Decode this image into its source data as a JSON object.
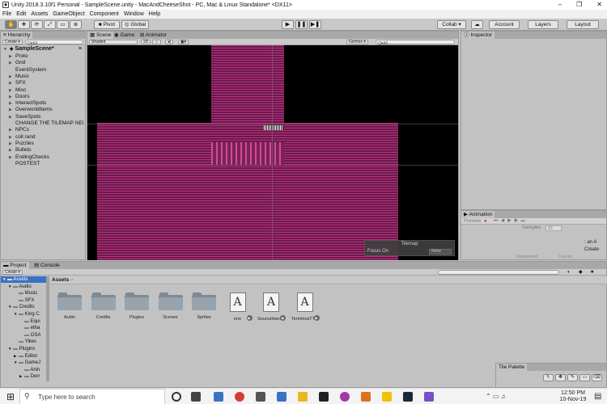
{
  "window": {
    "title": "Unity 2018.3.10f1 Personal - SampleScene.unity - MacAndCheeseShot - PC, Mac & Linux Standalone* <DX11>",
    "controls": [
      "–",
      "❐",
      "✕"
    ]
  },
  "menu": [
    "File",
    "Edit",
    "Assets",
    "GameObject",
    "Component",
    "Window",
    "Help"
  ],
  "toolbar": {
    "tools": [
      "✋",
      "✥",
      "⟳",
      "⤢",
      "▭",
      "⊕"
    ],
    "pivot_label": "Pivot",
    "global_label": "Global",
    "play": "▶",
    "pause": "❚❚",
    "step": "▶❚",
    "collab_label": "Collab ▾",
    "cloud_icon": "☁",
    "account_label": "Account",
    "layers_label": "Layers",
    "layout_label": "Layout"
  },
  "hierarchy": {
    "tab": "Hierarchy",
    "create_label": "Create ▾",
    "search_prefix": "Q▾All",
    "scene_name": "SampleScene*",
    "items": [
      {
        "label": "Proto",
        "arrow": "▶"
      },
      {
        "label": "Grid",
        "arrow": "▶"
      },
      {
        "label": "EventSystem",
        "arrow": ""
      },
      {
        "label": "Music",
        "arrow": "▶"
      },
      {
        "label": "SFX",
        "arrow": "▶"
      },
      {
        "label": "Misc",
        "arrow": "▶"
      },
      {
        "label": "Doors",
        "arrow": "▶"
      },
      {
        "label": "InteractSpots",
        "arrow": "▶"
      },
      {
        "label": "OverworldItems",
        "arrow": "▶"
      },
      {
        "label": "SaveSpots",
        "arrow": "▶"
      },
      {
        "label": "CHANGE THE TILEMAP NEI",
        "arrow": ""
      },
      {
        "label": "NPCs",
        "arrow": "▶"
      },
      {
        "label": "coll rand",
        "arrow": "▶"
      },
      {
        "label": "Puzzles",
        "arrow": "▶"
      },
      {
        "label": "Bullets",
        "arrow": "▶"
      },
      {
        "label": "EndingChecks",
        "arrow": "▶"
      },
      {
        "label": "POSTEST",
        "arrow": ""
      }
    ]
  },
  "scene": {
    "tabs": [
      "Scene",
      "Game",
      "Animator"
    ],
    "shading": "Shaded",
    "mode_2d": "2D",
    "gizmos": "Gizmos ▾",
    "search_prefix": "Q▾All",
    "tilemap_overlay": {
      "title": "Tilemap",
      "focus_label": "Focus On",
      "focus_value": "None"
    }
  },
  "inspector": {
    "tab": "Inspector"
  },
  "animation": {
    "tab": "Animation",
    "preview_label": "Preview",
    "samples_label": "Samples",
    "samples_value": "60",
    "dopesheet_label": "Dopesheet",
    "curves_label": "Curves",
    "side_text_1": ": an A",
    "side_text_2": "Create"
  },
  "project": {
    "tabs": [
      "Project",
      "Console"
    ],
    "create_label": "Create ▾",
    "breadcrumb": "Assets",
    "tree": [
      {
        "label": "Assets",
        "indent": 0,
        "arrow": "▼",
        "selected": true
      },
      {
        "label": "Audio",
        "indent": 1,
        "arrow": "▼"
      },
      {
        "label": "Music",
        "indent": 2,
        "arrow": ""
      },
      {
        "label": "SFX",
        "indent": 2,
        "arrow": ""
      },
      {
        "label": "Credits",
        "indent": 1,
        "arrow": "▼"
      },
      {
        "label": "King C",
        "indent": 2,
        "arrow": "▼"
      },
      {
        "label": "Equi",
        "indent": 3,
        "arrow": ""
      },
      {
        "label": "etha",
        "indent": 3,
        "arrow": ""
      },
      {
        "label": "OSA",
        "indent": 3,
        "arrow": ""
      },
      {
        "label": "Yikes",
        "indent": 2,
        "arrow": ""
      },
      {
        "label": "Plugins",
        "indent": 1,
        "arrow": "▼"
      },
      {
        "label": "Editor",
        "indent": 2,
        "arrow": "▶"
      },
      {
        "label": "GameJ",
        "indent": 2,
        "arrow": "▼"
      },
      {
        "label": "Anin",
        "indent": 3,
        "arrow": ""
      },
      {
        "label": "Derr",
        "indent": 3,
        "arrow": "▶"
      }
    ],
    "assets": [
      {
        "label": "Audio",
        "type": "folder"
      },
      {
        "label": "Credits",
        "type": "folder"
      },
      {
        "label": "Plugins",
        "type": "folder"
      },
      {
        "label": "Scenes",
        "type": "folder"
      },
      {
        "label": "Sprites",
        "type": "folder"
      },
      {
        "label": "enn",
        "type": "font"
      },
      {
        "label": "SourceHanSi...",
        "type": "font"
      },
      {
        "label": "TerminusTT...",
        "type": "font"
      }
    ],
    "font_glyph": "A",
    "expand_glyph": "▶"
  },
  "tile_palette": {
    "tab": "Tile Palette"
  },
  "taskbar": {
    "search_placeholder": "Type here to search",
    "time": "12:50 PM",
    "date": "10-Nov-19"
  },
  "colors": {
    "scene_bg": "#000000",
    "tile_pink": "#b8307e",
    "accent_blue": "#3a72c4"
  }
}
